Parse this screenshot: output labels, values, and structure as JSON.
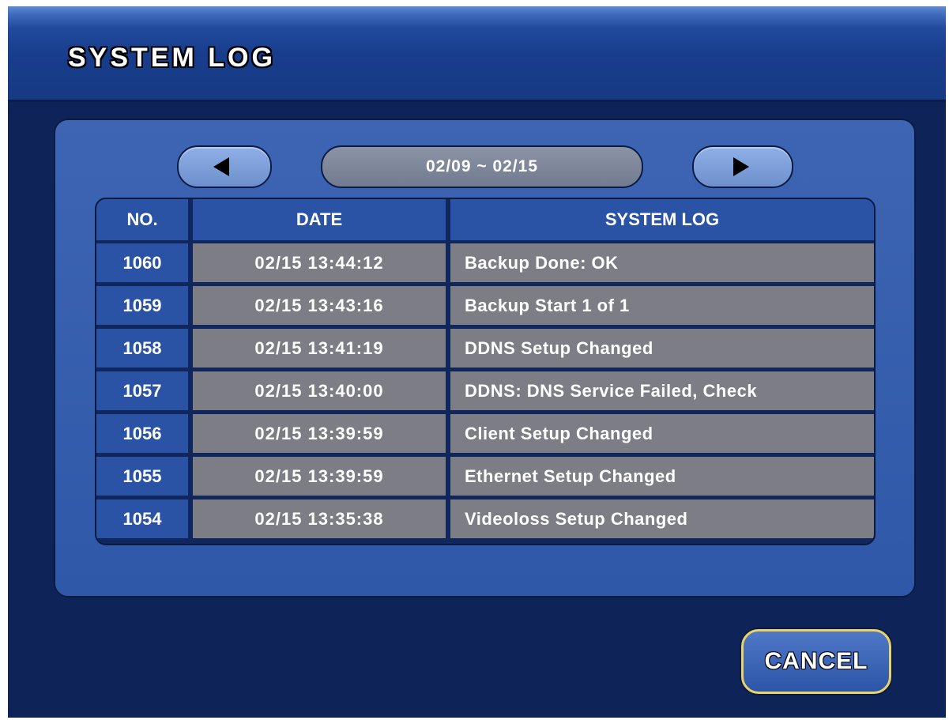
{
  "header": {
    "title": "SYSTEM LOG"
  },
  "nav": {
    "prev_icon": "triangle-left-icon",
    "next_icon": "triangle-right-icon",
    "date_range": "02/09 ~ 02/15"
  },
  "table": {
    "columns": [
      "NO.",
      "DATE",
      "SYSTEM LOG"
    ],
    "rows": [
      {
        "no": "1060",
        "date": "02/15 13:44:12",
        "log": "Backup Done: OK"
      },
      {
        "no": "1059",
        "date": "02/15 13:43:16",
        "log": "Backup Start 1 of 1"
      },
      {
        "no": "1058",
        "date": "02/15 13:41:19",
        "log": "DDNS Setup Changed"
      },
      {
        "no": "1057",
        "date": "02/15 13:40:00",
        "log": "DDNS: DNS Service Failed, Check"
      },
      {
        "no": "1056",
        "date": "02/15 13:39:59",
        "log": "Client Setup Changed"
      },
      {
        "no": "1055",
        "date": "02/15 13:39:59",
        "log": "Ethernet Setup Changed"
      },
      {
        "no": "1054",
        "date": "02/15 13:35:38",
        "log": "Videoloss Setup Changed"
      }
    ]
  },
  "footer": {
    "cancel_label": "CANCEL"
  },
  "colors": {
    "background": "#0e2458",
    "accent": "#2b53a5",
    "cell_gray": "#7d7d86",
    "cancel_border": "#e8d36a"
  }
}
